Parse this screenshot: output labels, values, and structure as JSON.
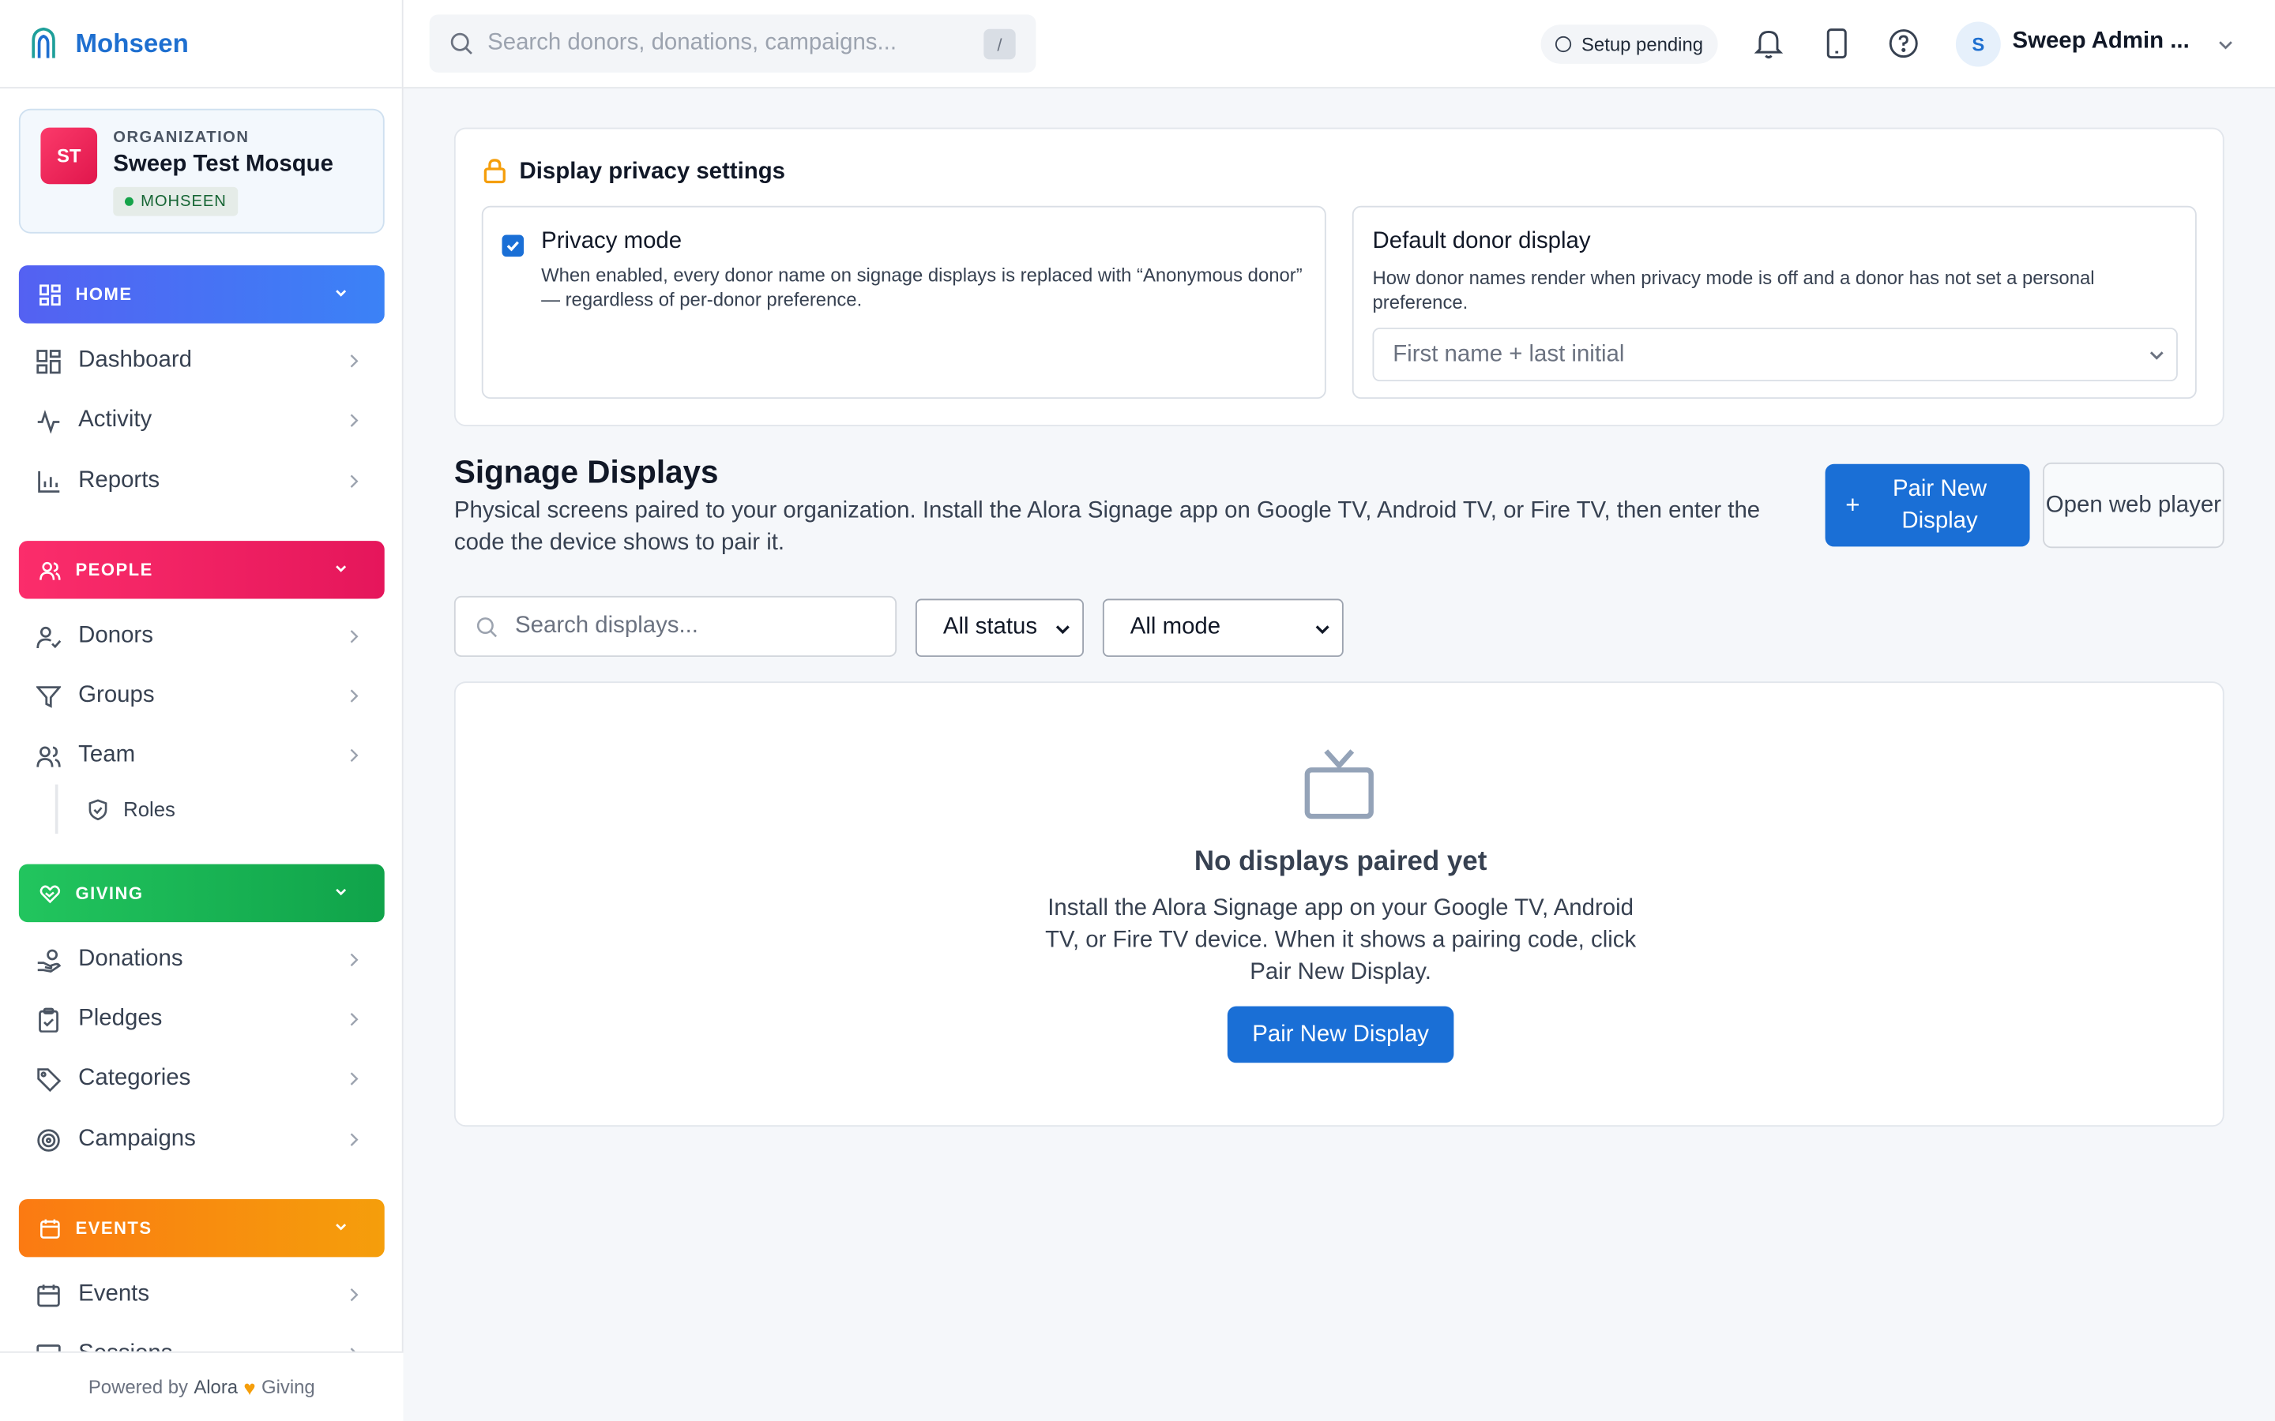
{
  "brand": {
    "name": "Mohseen"
  },
  "organization": {
    "label": "ORGANIZATION",
    "initials": "ST",
    "name": "Sweep Test Mosque",
    "badge": "MOHSEEN"
  },
  "sidebar": {
    "sections": [
      {
        "label": "HOME",
        "items": [
          {
            "label": "Dashboard",
            "icon": "grid-icon"
          },
          {
            "label": "Activity",
            "icon": "activity-icon"
          },
          {
            "label": "Reports",
            "icon": "bar-chart-icon"
          }
        ]
      },
      {
        "label": "PEOPLE",
        "items": [
          {
            "label": "Donors",
            "icon": "user-check-icon"
          },
          {
            "label": "Groups",
            "icon": "filter-icon"
          },
          {
            "label": "Team",
            "icon": "users-icon",
            "subitems": [
              {
                "label": "Roles",
                "icon": "shield-icon"
              }
            ]
          }
        ]
      },
      {
        "label": "GIVING",
        "items": [
          {
            "label": "Donations",
            "icon": "hand-coins-icon"
          },
          {
            "label": "Pledges",
            "icon": "clipboard-check-icon"
          },
          {
            "label": "Categories",
            "icon": "tag-icon"
          },
          {
            "label": "Campaigns",
            "icon": "target-icon"
          }
        ]
      },
      {
        "label": "EVENTS",
        "items": [
          {
            "label": "Events",
            "icon": "calendar-icon"
          },
          {
            "label": "Sessions",
            "icon": "monitor-icon"
          }
        ]
      }
    ],
    "footer": {
      "prefix": "Powered by",
      "brand1": "Alora",
      "brand2": "Giving"
    }
  },
  "topbar": {
    "search_placeholder": "Search donors, donations, campaigns...",
    "search_shortcut": "/",
    "setup_status": "Setup pending",
    "user_initial": "S",
    "user_name": "Sweep Admin ..."
  },
  "privacy": {
    "title": "Display privacy settings",
    "privacy_mode": {
      "label": "Privacy mode",
      "checked": true,
      "description": "When enabled, every donor name on signage displays is replaced with “Anonymous donor” — regardless of per-donor preference."
    },
    "default_display": {
      "label": "Default donor display",
      "description": "How donor names render when privacy mode is off and a donor has not set a personal preference.",
      "value": "First name + last initial"
    }
  },
  "signage": {
    "title": "Signage Displays",
    "description": "Physical screens paired to your organization. Install the Alora Signage app on Google TV, Android TV, or Fire TV, then enter the code the device shows to pair it.",
    "pair_button": "Pair New Display",
    "web_player_button": "Open web player",
    "search_placeholder": "Search displays...",
    "status_filter": "All status",
    "mode_filter": "All mode",
    "empty": {
      "title": "No displays paired yet",
      "description": "Install the Alora Signage app on your Google TV, Android TV, or Fire TV device. When it shows a pairing code, click Pair New Display.",
      "button": "Pair New Display"
    }
  },
  "colors": {
    "accent": "#1a6fd6",
    "home": "#5461f2",
    "people": "#fb2d6b",
    "giving": "#22c55e",
    "events": "#fb7a12"
  }
}
